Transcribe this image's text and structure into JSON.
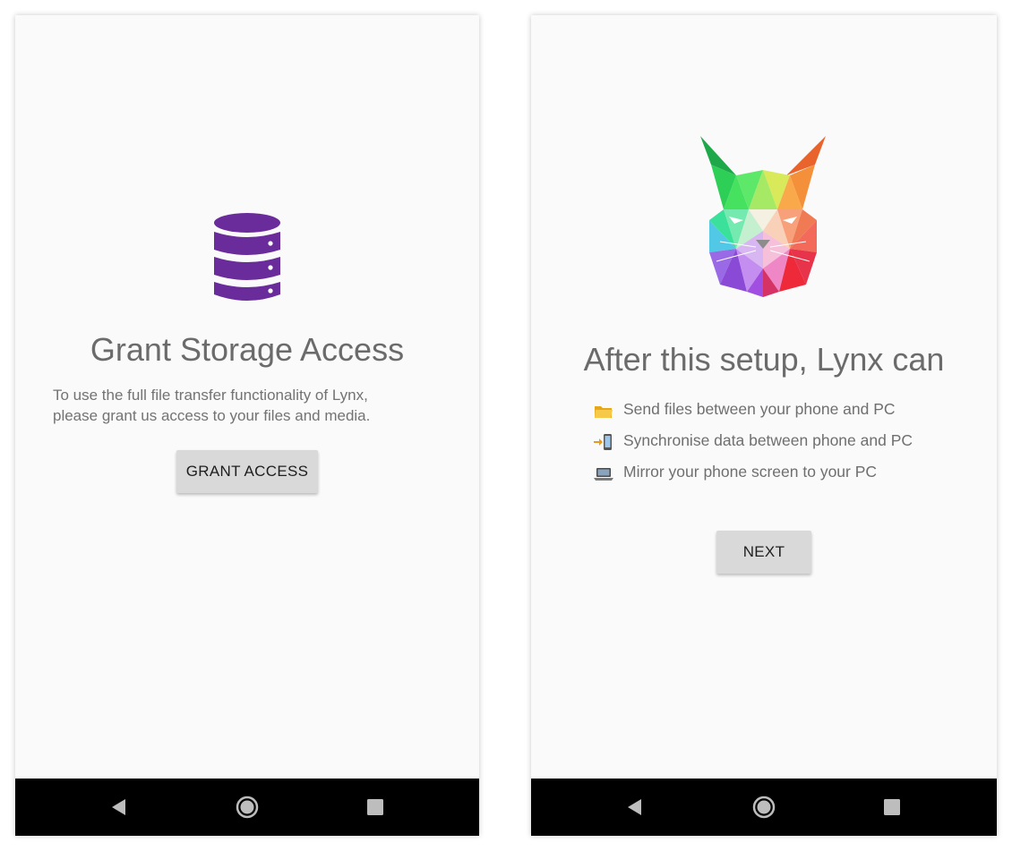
{
  "left_screen": {
    "icon": "database-icon",
    "title": "Grant Storage Access",
    "description_lines": [
      "To use the full file transfer functionality of Lynx,",
      "please grant us access to your files and media."
    ],
    "button_label": "GRANT ACCESS"
  },
  "right_screen": {
    "logo": "lynx-logo",
    "title": "After this setup, Lynx can",
    "features": [
      {
        "icon": "folder-icon",
        "label": "Send files between your phone and PC"
      },
      {
        "icon": "phone-sync-icon",
        "label": "Synchronise data between phone and PC"
      },
      {
        "icon": "laptop-icon",
        "label": "Mirror your phone screen to your PC"
      }
    ],
    "button_label": "NEXT"
  },
  "navbar": {
    "buttons": [
      "back-icon",
      "home-icon",
      "recents-icon"
    ]
  },
  "colors": {
    "accent_purple": "#6a2c9a",
    "screen_bg": "#fafafa",
    "navbar_bg": "#000000",
    "button_bg": "#d9d9d9"
  }
}
